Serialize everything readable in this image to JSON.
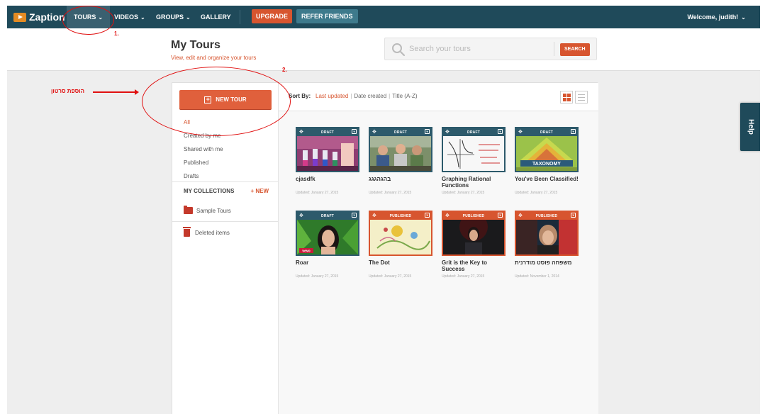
{
  "nav": {
    "logo": "Zaption",
    "items": [
      {
        "label": "TOURS"
      },
      {
        "label": "VIDEOS"
      },
      {
        "label": "GROUPS"
      },
      {
        "label": "GALLERY"
      }
    ],
    "upgrade": "UPGRADE",
    "refer": "REFER FRIENDS",
    "welcome": "Welcome, judith!"
  },
  "header": {
    "title": "My Tours",
    "subtitle": "View, edit and organize your tours",
    "search_placeholder": "Search your tours",
    "search_button": "SEARCH"
  },
  "sidebar": {
    "new_tour": "NEW TOUR",
    "items": [
      "All",
      "Created by me",
      "Shared with me",
      "Published",
      "Drafts"
    ],
    "collections_label": "MY COLLECTIONS",
    "collections_new": "+ NEW",
    "folder": "Sample Tours",
    "deleted": "Deleted items"
  },
  "sort": {
    "label": "Sort By:",
    "options": [
      "Last updated",
      "Date created",
      "Title (A-Z)"
    ]
  },
  "cards": [
    {
      "title": "cjasdfk",
      "date": "Updated: January 27, 2015",
      "status": "DRAFT"
    },
    {
      "title": "בהגהגגג",
      "date": "Updated: January 27, 2015",
      "status": "DRAFT"
    },
    {
      "title": "Graphing Rational Functions",
      "date": "Updated: January 27, 2015",
      "status": "DRAFT"
    },
    {
      "title": "You've Been Classified!",
      "date": "Updated: January 27, 2015",
      "status": "DRAFT",
      "thumb_text": "TAXONOMY"
    },
    {
      "title": "Roar",
      "date": "Updated: January 27, 2015",
      "status": "DRAFT",
      "thumb_text": "vevo"
    },
    {
      "title": "The Dot",
      "date": "Updated: January 27, 2015",
      "status": "PUBLISHED"
    },
    {
      "title": "Grit is the Key to Success",
      "date": "Updated: January 27, 2015",
      "status": "PUBLISHED"
    },
    {
      "title": "משפחה פוסט מודרנית",
      "date": "Updated: November 1, 2014",
      "status": "PUBLISHED"
    }
  ],
  "help": "Help",
  "annotations": {
    "step1": "1.",
    "step2": "2.",
    "hebrew_note": "הוספת סרטון"
  },
  "colors": {
    "nav": "#1f4a5a",
    "accent": "#d7552f",
    "draft": "#2d5a6b",
    "annotation": "#e01010"
  }
}
